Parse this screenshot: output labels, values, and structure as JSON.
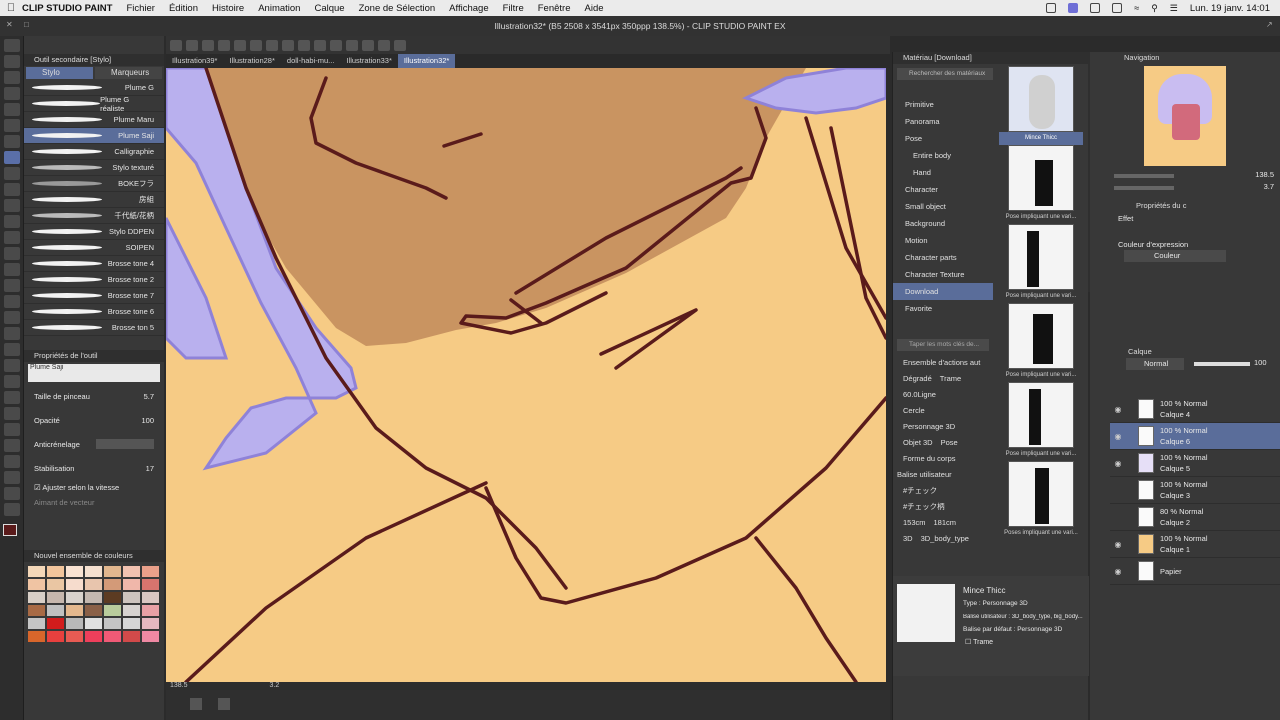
{
  "menubar": {
    "app_name": "CLIP STUDIO PAINT",
    "items": [
      "Fichier",
      "Édition",
      "Histoire",
      "Animation",
      "Calque",
      "Zone de Sélection",
      "Affichage",
      "Filtre",
      "Fenêtre",
      "Aide"
    ],
    "clock": "Lun. 19 janv. 14:01"
  },
  "window_title": "Illustration32* (B5 2508 x 3541px 350ppp 138.5%) - CLIP STUDIO PAINT EX",
  "doc_tabs": [
    "Illustration39*",
    "Illustration28*",
    "doll-habi-mu...",
    "Illustration33*",
    "Illustration32*"
  ],
  "active_doc_tab": 4,
  "sub_tool": {
    "panel_title": "Outil secondaire [Stylo]",
    "tabs": [
      "Stylo",
      "Marqueurs"
    ],
    "brushes": [
      "Plume G",
      "Plume G réaliste",
      "Plume Maru",
      "Plume Saji",
      "Calligraphie",
      "Stylo texturé",
      "BOKEフラ",
      "房組",
      "千代紙/花柄",
      "Stylo DDPEN",
      "SOIPEN",
      "Brosse tone 4",
      "Brosse tone 2",
      "Brosse tone 7",
      "Brosse tone 6",
      "Brosse ton 5"
    ],
    "selected_brush": 3
  },
  "tool_props": {
    "panel_title": "Propriétés de l'outil",
    "preview_label": "Plume Saji",
    "size_label": "Taille de pinceau",
    "size_value": "5.7",
    "opacity_label": "Opacité",
    "opacity_value": "100",
    "aa_label": "Anticrénelage",
    "stab_label": "Stabilisation",
    "stab_value": "17",
    "speed_label": "Ajuster selon la vitesse",
    "vector_label": "Aimant de vecteur"
  },
  "palette": {
    "title": "Nouvel ensemble de couleurs",
    "colors": [
      "#f4d7b8",
      "#f2c59c",
      "#f9e3d2",
      "#f5e0cf",
      "#e2b78e",
      "#f2c2b0",
      "#eaa08a",
      "#f0c4a3",
      "#eac6a3",
      "#f6dccd",
      "#e8c5ad",
      "#d39a78",
      "#f0b7aa",
      "#d7746e",
      "#d8cfc7",
      "#c7b7ad",
      "#d8d2cc",
      "#c4b8b0",
      "#5c3b22",
      "#cdc4be",
      "#dac7c2",
      "#a86a45",
      "#c0c0c0",
      "#e4b88e",
      "#8a6047",
      "#b9cc9c",
      "#d7d3d0",
      "#e8a0a5",
      "#c5c5c5",
      "#d21c1c",
      "#b9b9b9",
      "#e0e0e0",
      "#c4c4c4",
      "#d6d6d6",
      "#e5b8c0",
      "#d8662b",
      "#e8403e",
      "#e85b53",
      "#ee3f5b",
      "#f05a76",
      "#d14a4a",
      "#ef89a3"
    ]
  },
  "canvas": {
    "zoom": "138.5",
    "angle": "3.2"
  },
  "material": {
    "panel_title": "Matériau [Download]",
    "search_placeholder": "Rechercher des matériaux",
    "tree": [
      "Primitive",
      "Panorama",
      "Pose",
      "Entire body",
      "Hand",
      "Character",
      "Small object",
      "Background",
      "Motion",
      "Character parts",
      "Character Texture",
      "Download",
      "Favorite"
    ],
    "tree_sub": [
      false,
      false,
      false,
      true,
      true,
      false,
      false,
      false,
      false,
      false,
      false,
      false,
      false
    ],
    "tree_selected": 11,
    "keyword_placeholder": "Taper les mots clés de...",
    "tags": [
      [
        "Ensemble d'actions aut"
      ],
      [
        "Dégradé",
        "Trame"
      ],
      [
        "60.0Ligne"
      ],
      [
        "Cercle"
      ],
      [
        "Personnage 3D"
      ],
      [
        "Objet 3D",
        "Pose"
      ],
      [
        "Forme du corps"
      ]
    ],
    "user_tag_label": "Balise utilisateur",
    "user_tags": [
      [
        "#チェック"
      ],
      [
        "#チェック柄"
      ],
      [
        "153cm",
        "181cm"
      ],
      [
        "3D",
        "3D_body_type"
      ]
    ],
    "thumbs": [
      "Mince Thicc",
      "Pose impliquant une vari...",
      "Pose impliquant une vari...",
      "Pose impliquant une vari...",
      "Pose impliquant une vari...",
      "Poses impliquant une vari..."
    ],
    "detail": {
      "name": "Mince Thicc",
      "type": "Type : Personnage 3D",
      "user_tags": "Balise utilisateur : 3D_body_type, big_body...",
      "default_tags": "Balise par défaut : Personnage 3D",
      "trame": "Trame"
    }
  },
  "navigation": {
    "title": "Navigation",
    "zoom": "138.5",
    "angle": "3.7"
  },
  "layer_props": {
    "title": "Propriétés du c",
    "effect_label": "Effet",
    "expression_label": "Couleur d'expression",
    "expression_value": "Couleur"
  },
  "layers": {
    "title": "Calque",
    "blend": "Normal",
    "opacity": "100",
    "items": [
      {
        "mode": "100 % Normal",
        "name": "Calque 4"
      },
      {
        "mode": "100 % Normal",
        "name": "Calque 6"
      },
      {
        "mode": "100 % Normal",
        "name": "Calque 5"
      },
      {
        "mode": "100 % Normal",
        "name": "Calque 3"
      },
      {
        "mode": "80 % Normal",
        "name": "Calque 2"
      },
      {
        "mode": "100 % Normal",
        "name": "Calque 1"
      },
      {
        "mode": "",
        "name": "Papier"
      }
    ],
    "selected": 1
  },
  "colors": {
    "accent": "#5a6d9a",
    "skin": "#f6cb85",
    "shadow": "#c99461",
    "hair": "#b9b0ee",
    "line": "#5a1b1b"
  }
}
